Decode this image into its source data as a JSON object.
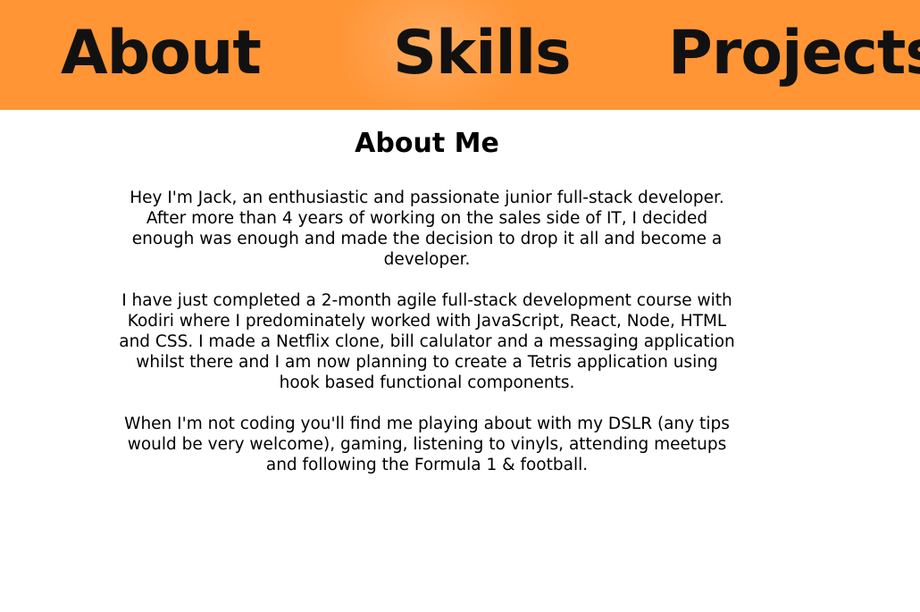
{
  "nav": {
    "about": "About",
    "skills": "Skills",
    "projects": "Projects"
  },
  "colors": {
    "nav_background": "#ff9535",
    "nav_text": "#111111"
  },
  "about": {
    "title": "About Me",
    "paragraphs": [
      "Hey I'm Jack, an enthusiastic and passionate junior full-stack developer. After more than 4 years of working on the sales side of IT, I decided enough was enough and made the decision to drop it all and become a developer.",
      "I have just completed a 2-month agile full-stack development course with Kodiri where I predominately worked with JavaScript, React, Node, HTML and CSS. I made a Netflix clone, bill calulator and a messaging application whilst there and I am now planning to create a Tetris application using hook based functional components.",
      "When I'm not coding you'll find me playing about with my DSLR (any tips would be very welcome), gaming, listening to vinyls, attending meetups and following the Formula 1 & football."
    ]
  }
}
